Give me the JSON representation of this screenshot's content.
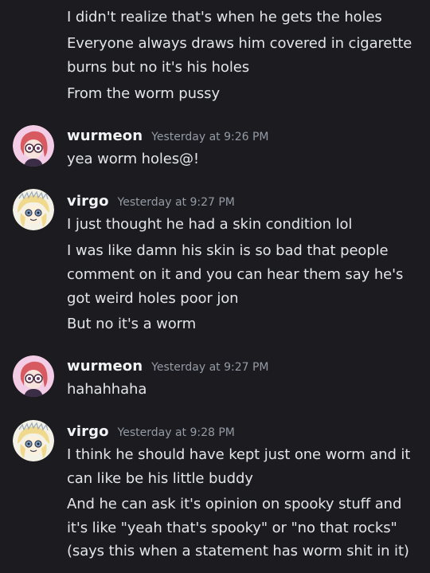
{
  "colors": {
    "background": "#1b1b20",
    "message_text": "#e3e5e8",
    "username": "#f2f3f5",
    "timestamp": "#949ba4"
  },
  "continuation_lines": [
    "I didn't realize that's when he gets the holes",
    "Everyone always draws him covered in cigarette",
    "burns but no it's his holes",
    "From the worm pussy"
  ],
  "messages": [
    {
      "author": "wurmeon",
      "timestamp": "Yesterday at 9:26 PM",
      "avatar_icon": "pink-haired-character-avatar",
      "lines": [
        "yea worm holes@!"
      ]
    },
    {
      "author": "virgo",
      "timestamp": "Yesterday at 9:27 PM",
      "avatar_icon": "blonde-character-avatar",
      "lines": [
        "I just thought he had a skin condition lol",
        "I was like damn his skin is so bad that people",
        "comment on it and you can hear them say he's",
        "got weird holes poor jon",
        "But no it's a worm"
      ]
    },
    {
      "author": "wurmeon",
      "timestamp": "Yesterday at 9:27 PM",
      "avatar_icon": "pink-haired-character-avatar",
      "lines": [
        "hahahhaha"
      ]
    },
    {
      "author": "virgo",
      "timestamp": "Yesterday at 9:28 PM",
      "avatar_icon": "blonde-character-avatar",
      "lines": [
        "I think he should have kept just one worm and it",
        "can like be his little buddy",
        "And he can ask it's opinion on spooky stuff and",
        "it's like \"yeah that's spooky\" or \"no that rocks\"",
        "(says this when a statement has worm shit in it)"
      ]
    }
  ]
}
